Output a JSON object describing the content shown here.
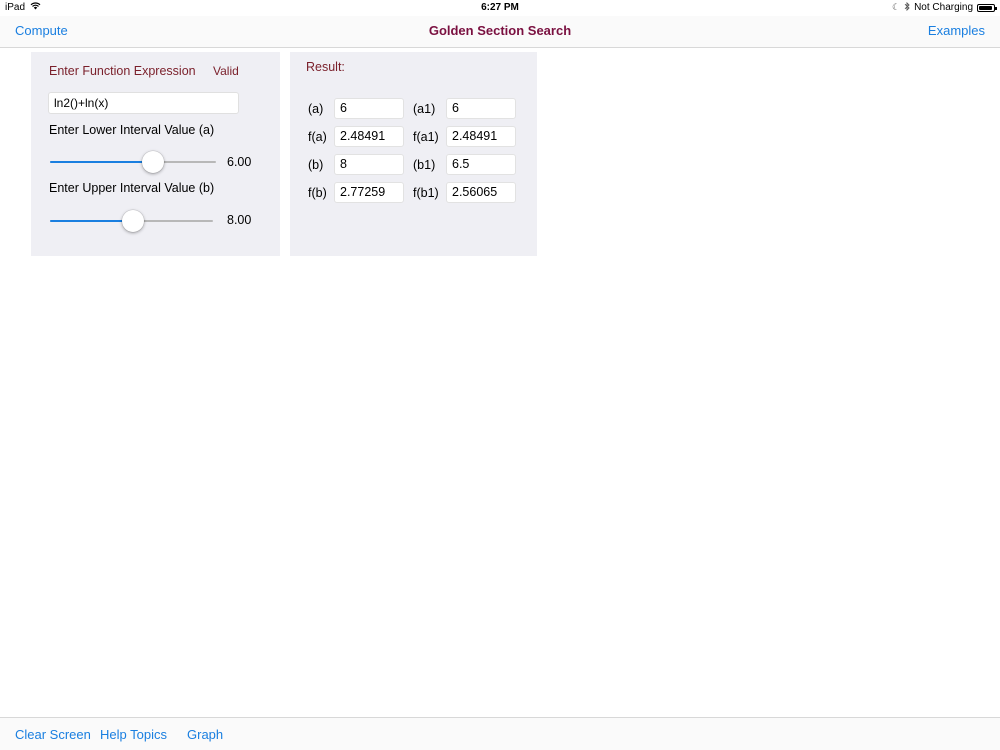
{
  "status_bar": {
    "device": "iPad",
    "wifi_icon": "wifi-icon",
    "time": "6:27 PM",
    "moon_icon": "moon-icon",
    "bluetooth_icon": "bluetooth-icon",
    "battery_text": "Not Charging",
    "battery_level": 0.9
  },
  "nav": {
    "left_label": "Compute",
    "title": "Golden Section Search",
    "right_label": "Examples"
  },
  "input_panel": {
    "function_label": "Enter Function Expression",
    "valid_label": "Valid",
    "function_value": "ln2()+ln(x)",
    "lower_label": "Enter Lower Interval Value (a)",
    "lower_value": "6.00",
    "lower_slider_fraction": 0.62,
    "upper_label": "Enter Upper Interval Value (b)",
    "upper_value": "8.00",
    "upper_slider_fraction": 0.51
  },
  "result_panel": {
    "title": "Result:",
    "rows": [
      {
        "label_left": "(a)",
        "value_left": "6",
        "label_right": "(a1)",
        "value_right": "6"
      },
      {
        "label_left": "f(a)",
        "value_left": "2.48491",
        "label_right": "f(a1)",
        "value_right": "2.48491"
      },
      {
        "label_left": "(b)",
        "value_left": "8",
        "label_right": "(b1)",
        "value_right": "6.5"
      },
      {
        "label_left": "f(b)",
        "value_left": "2.77259",
        "label_right": "f(b1)",
        "value_right": "2.56065"
      }
    ]
  },
  "toolbar": {
    "clear_label": "Clear Screen",
    "help_label": "Help Topics",
    "graph_label": "Graph"
  },
  "colors": {
    "accent": "#1a7fe0",
    "title": "#7a1040",
    "label": "#7a1f2a",
    "panel_bg": "#efeff4"
  }
}
